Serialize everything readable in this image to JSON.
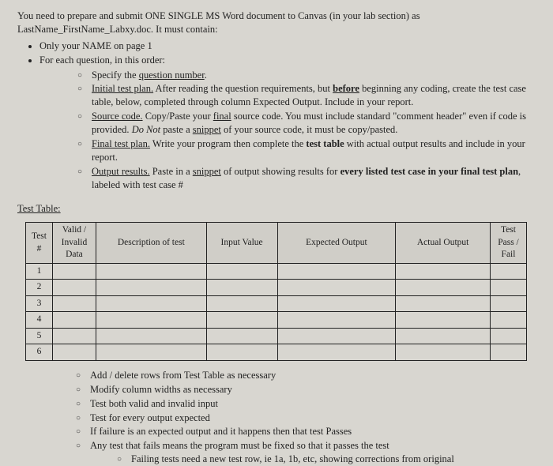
{
  "intro": "You need to prepare and submit ONE SINGLE MS Word document to Canvas (in your lab section) as LastName_FirstName_Labxy.doc. It must contain:",
  "main_bullets": {
    "b1": "Only your NAME on page 1",
    "b2": "For each question, in this order:"
  },
  "sub_bullets": {
    "s1_a": "Specify the ",
    "s1_b": "question number",
    "s1_c": ".",
    "s2_a": "Initial test plan.",
    "s2_b": " After reading the question requirements, but ",
    "s2_c": "before",
    "s2_d": " beginning any coding, create the test case table, below, completed through column Expected Output. Include in your report.",
    "s3_a": "Source code.",
    "s3_b": " Copy/Paste your ",
    "s3_c": "final",
    "s3_d": " source code. You must include standard \"comment header\" even if code is provided. ",
    "s3_e": "Do Not",
    "s3_f": " paste a ",
    "s3_g": "snippet",
    "s3_h": " of your source code, it must be copy/pasted.",
    "s4_a": "Final test plan.",
    "s4_b": "  Write your program then complete the ",
    "s4_c": "test table",
    "s4_d": " with actual output results and include in your report.",
    "s5_a": "Output results.",
    "s5_b": " Paste in a ",
    "s5_c": "snippet",
    "s5_d": " of output showing results for ",
    "s5_e": "every listed test case in your final test plan",
    "s5_f": ", labeled with test case #"
  },
  "table_label": "Test Table:",
  "headers": {
    "h1": "Test #",
    "h2": "Valid / Invalid Data",
    "h3": "Description of test",
    "h4": "Input Value",
    "h5": "Expected Output",
    "h6": "Actual Output",
    "h7": "Test Pass / Fail"
  },
  "rows": [
    "1",
    "2",
    "3",
    "4",
    "5",
    "6"
  ],
  "notes": {
    "n1": "Add / delete rows from Test Table as necessary",
    "n2": "Modify column widths as necessary",
    "n3": "Test both valid and invalid input",
    "n4": "Test for every output expected",
    "n5": "If failure is an expected output and it happens then that test Passes",
    "n6": "Any test that fails means the program must be fixed so that it passes the test",
    "n6a": "Failing tests need a new test row, ie 1a, 1b, etc, showing corrections from original"
  }
}
